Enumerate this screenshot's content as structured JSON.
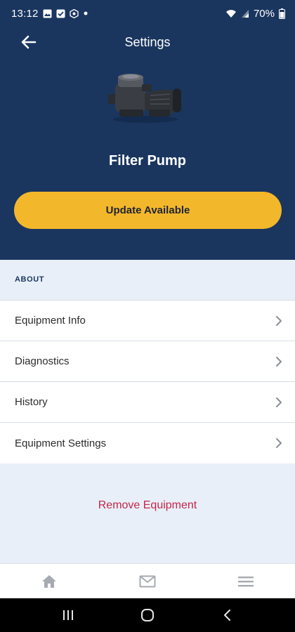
{
  "status_bar": {
    "time": "13:12",
    "battery": "70%",
    "icons_left": [
      "gallery-icon",
      "checkbox-icon",
      "settings-icon",
      "dot-icon"
    ],
    "icons_right": [
      "wifi-icon",
      "signal-icon",
      "battery-icon"
    ]
  },
  "header": {
    "title": "Settings",
    "equipment_name": "Filter Pump",
    "update_button": "Update Available",
    "background_color": "#1a365f",
    "accent_color": "#f3b72b"
  },
  "about": {
    "section_label": "ABOUT",
    "items": [
      {
        "label": "Equipment Info"
      },
      {
        "label": "Diagnostics"
      },
      {
        "label": "History"
      },
      {
        "label": "Equipment Settings"
      }
    ]
  },
  "remove_button": "Remove Equipment",
  "remove_color": "#c4264a",
  "bottom_nav": [
    "home-icon",
    "mail-icon",
    "menu-icon"
  ],
  "system_nav": [
    "recent-apps-icon",
    "home-circle-icon",
    "back-icon"
  ]
}
